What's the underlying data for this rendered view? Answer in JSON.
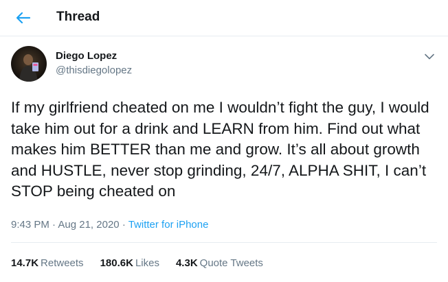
{
  "header": {
    "back_icon": "arrow-left-icon",
    "title": "Thread"
  },
  "tweet": {
    "author": {
      "name": "Diego Lopez",
      "handle": "@thisdiegolopez",
      "avatar_icon": "user-photo"
    },
    "text": "If my girlfriend cheated on me I wouldn’t fight the guy, I would take him out for a drink and LEARN from him. Find out what makes him BETTER than me and grow. It’s all about growth and HUSTLE, never stop grinding, 24/7, ALPHA SHIT, I can’t STOP being cheated on",
    "time": "9:43 PM",
    "separator": "·",
    "date": "Aug 21, 2020",
    "source": "Twitter for iPhone",
    "stats": {
      "retweets_count": "14.7K",
      "retweets_label": "Retweets",
      "likes_count": "180.6K",
      "likes_label": "Likes",
      "quotes_count": "4.3K",
      "quotes_label": "Quote Tweets"
    }
  },
  "colors": {
    "accent": "#1da1f2",
    "text_primary": "#14171a",
    "text_secondary": "#657786",
    "divider": "#e6ecf0"
  }
}
